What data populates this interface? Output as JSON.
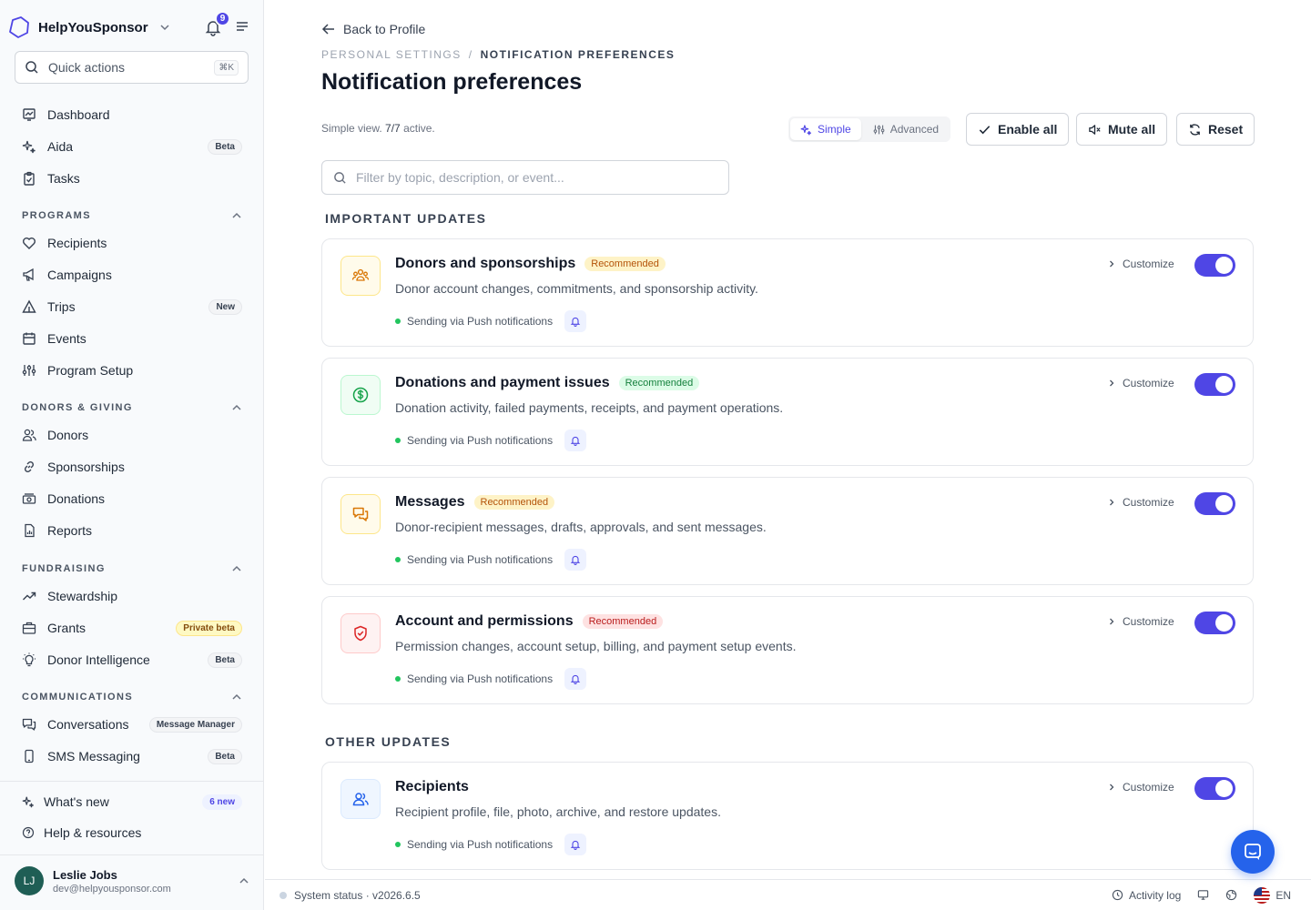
{
  "brand": {
    "name": "HelpYouSponsor",
    "notification_count": "9"
  },
  "quick_actions": {
    "label": "Quick actions",
    "shortcut": "⌘K"
  },
  "nav": {
    "dashboard": "Dashboard",
    "aida": "Aida",
    "aida_badge": "Beta",
    "tasks": "Tasks",
    "programs_header": "PROGRAMS",
    "recipients": "Recipients",
    "campaigns": "Campaigns",
    "trips": "Trips",
    "trips_badge": "New",
    "events": "Events",
    "program_setup": "Program Setup",
    "donors_header": "DONORS & GIVING",
    "donors": "Donors",
    "sponsorships": "Sponsorships",
    "donations": "Donations",
    "reports": "Reports",
    "fundraising_header": "FUNDRAISING",
    "stewardship": "Stewardship",
    "grants": "Grants",
    "grants_badge": "Private beta",
    "donor_intelligence": "Donor Intelligence",
    "donor_intelligence_badge": "Beta",
    "communications_header": "COMMUNICATIONS",
    "conversations": "Conversations",
    "conversations_badge": "Message Manager",
    "sms": "SMS Messaging",
    "sms_badge": "Beta",
    "whats_new": "What's new",
    "whats_new_badge": "6 new",
    "help": "Help & resources"
  },
  "user": {
    "initials": "LJ",
    "name": "Leslie Jobs",
    "email": "dev@helpyousponsor.com"
  },
  "header": {
    "back": "Back to Profile",
    "crumb_parent": "PERSONAL SETTINGS",
    "crumb_sep": "/",
    "crumb_current": "NOTIFICATION PREFERENCES",
    "title": "Notification preferences",
    "summary_prefix": "Simple view.",
    "summary_count": "7/7",
    "summary_suffix": "active."
  },
  "view_toggle": {
    "simple": "Simple",
    "advanced": "Advanced",
    "selected": "Simple"
  },
  "actions": {
    "enable_all": "Enable all",
    "mute_all": "Mute all",
    "reset": "Reset"
  },
  "filter": {
    "placeholder": "Filter by topic, description, or event...",
    "value": ""
  },
  "groups": {
    "important": "IMPORTANT UPDATES",
    "other": "OTHER UPDATES"
  },
  "cards": [
    {
      "title": "Donors and sponsorships",
      "badge": "Recommended",
      "desc": "Donor account changes, commitments, and sponsorship activity.",
      "sending": "Sending via Push notifications",
      "customize": "Customize",
      "enabled": true,
      "icon": "users-group-icon",
      "color": "#d97706"
    },
    {
      "title": "Donations and payment issues",
      "badge": "Recommended",
      "desc": "Donation activity, failed payments, receipts, and payment operations.",
      "sending": "Sending via Push notifications",
      "customize": "Customize",
      "enabled": true,
      "icon": "dollar-circle-icon",
      "color": "#16a34a"
    },
    {
      "title": "Messages",
      "badge": "Recommended",
      "desc": "Donor-recipient messages, drafts, approvals, and sent messages.",
      "sending": "Sending via Push notifications",
      "customize": "Customize",
      "enabled": true,
      "icon": "chat-bubbles-icon",
      "color": "#d97706"
    },
    {
      "title": "Account and permissions",
      "badge": "Recommended",
      "desc": "Permission changes, account setup, billing, and payment setup events.",
      "sending": "Sending via Push notifications",
      "customize": "Customize",
      "enabled": true,
      "icon": "shield-check-icon",
      "color": "#dc2626"
    },
    {
      "title": "Recipients",
      "badge": "",
      "desc": "Recipient profile, file, photo, archive, and restore updates.",
      "sending": "Sending via Push notifications",
      "customize": "Customize",
      "enabled": true,
      "icon": "users-icon",
      "color": "#2563eb"
    }
  ],
  "footer": {
    "status": "System status · v2026.6.5",
    "activity_log": "Activity log",
    "language": "EN"
  },
  "colors": {
    "accent": "#4f46e5",
    "status_ok": "#22c55e",
    "chat": "#2563eb"
  }
}
